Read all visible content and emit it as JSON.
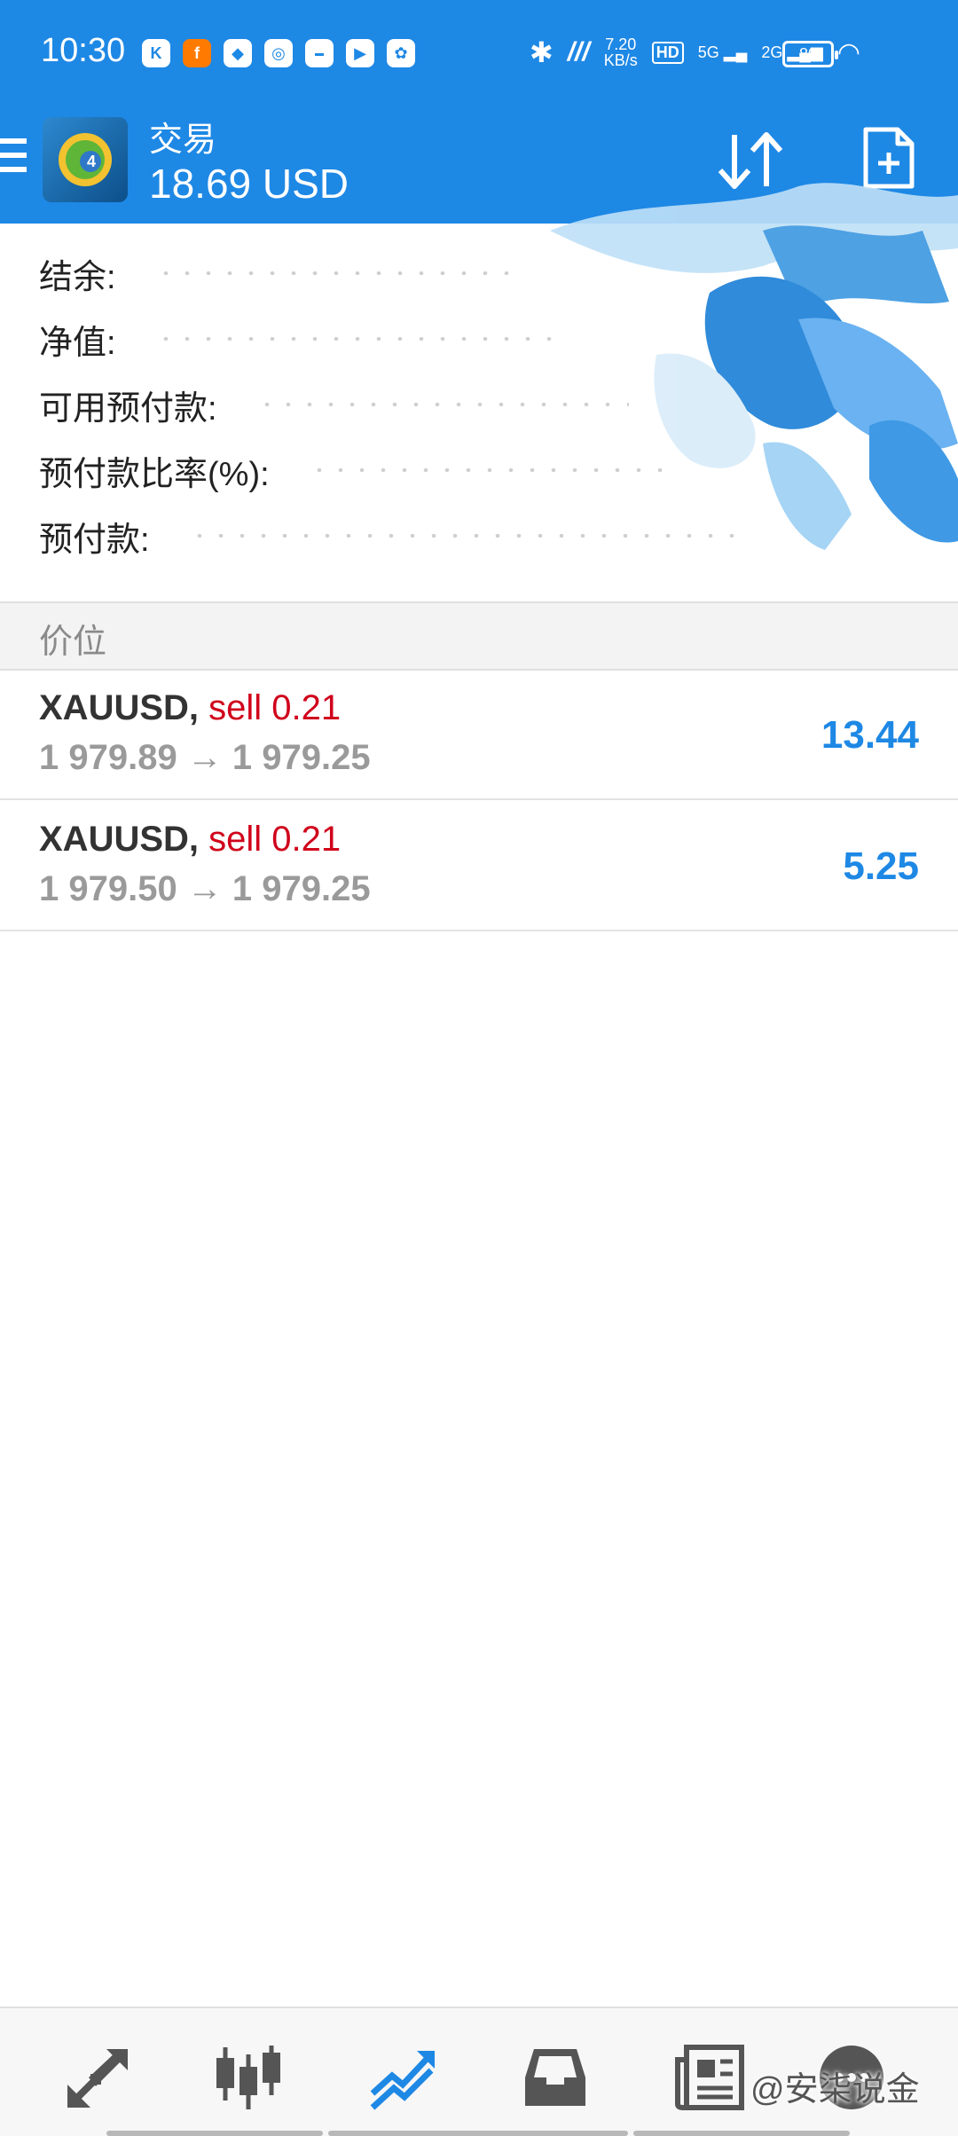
{
  "status_bar": {
    "time": "10:30",
    "network_speed": "7.20",
    "network_speed_unit": "KB/s",
    "hd": "HD",
    "sig_5g": "5G",
    "sig_2g": "2G",
    "battery": "80"
  },
  "app_bar": {
    "title": "交易",
    "subtitle": "18.69 USD"
  },
  "account": {
    "rows": [
      {
        "label": "结余:"
      },
      {
        "label": "净值:"
      },
      {
        "label": "可用预付款:"
      },
      {
        "label": "预付款比率(%):"
      },
      {
        "label": "预付款:"
      }
    ]
  },
  "section": {
    "title": "价位"
  },
  "positions": [
    {
      "symbol": "XAUUSD",
      "separator": ",",
      "side_volume": "sell 0.21",
      "prices": "1 979.89 → 1 979.25",
      "profit": "13.44"
    },
    {
      "symbol": "XAUUSD",
      "separator": ",",
      "side_volume": "sell 0.21",
      "prices": "1 979.50 → 1 979.25",
      "profit": "5.25"
    }
  ],
  "watermark": "@安柒说金",
  "colors": {
    "primary": "#1e88e5",
    "sell": "#d0021b",
    "profit": "#1e88e5"
  }
}
